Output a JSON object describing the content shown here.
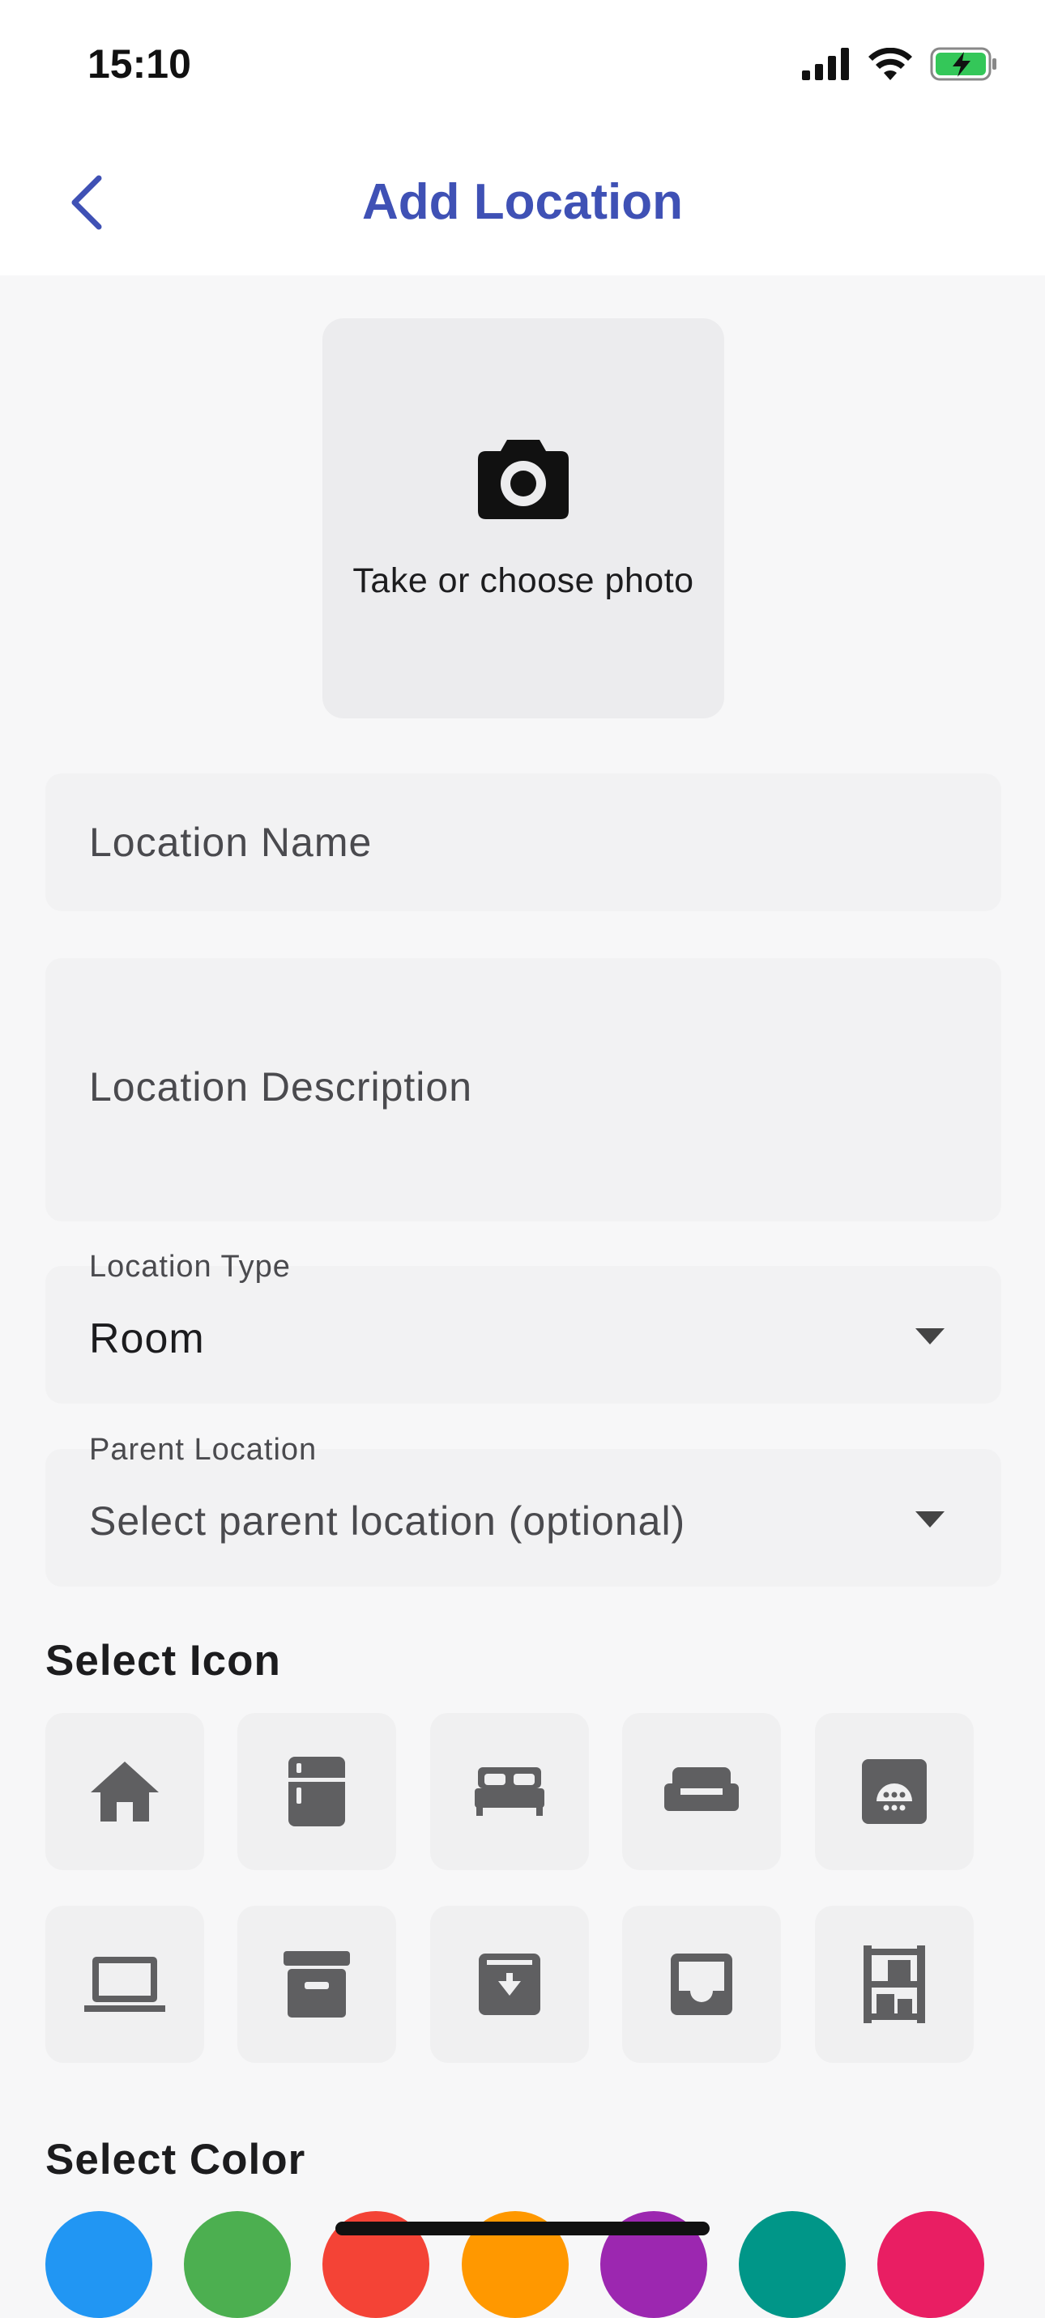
{
  "status_bar": {
    "time": "15:10"
  },
  "header": {
    "title": "Add Location"
  },
  "photo": {
    "label": "Take or choose photo"
  },
  "form": {
    "name_placeholder": "Location Name",
    "description_placeholder": "Location Description",
    "type_label": "Location Type",
    "type_value": "Room",
    "parent_label": "Parent Location",
    "parent_placeholder": "Select parent location (optional)"
  },
  "icon_section": {
    "title": "Select Icon",
    "icons": [
      "home-icon",
      "fridge-icon",
      "bed-icon",
      "sofa-icon",
      "dishwasher-icon",
      "laptop-icon",
      "archive-icon",
      "download-box-icon",
      "inbox-icon",
      "shelving-icon"
    ]
  },
  "color_section": {
    "title": "Select Color",
    "colors": [
      "#2196f3",
      "#4caf50",
      "#f44336",
      "#ff9800",
      "#9c27b0",
      "#009688",
      "#e91e63"
    ]
  },
  "theme": {
    "accent": "#3f51b5",
    "icon_color": "#5f5f61"
  }
}
